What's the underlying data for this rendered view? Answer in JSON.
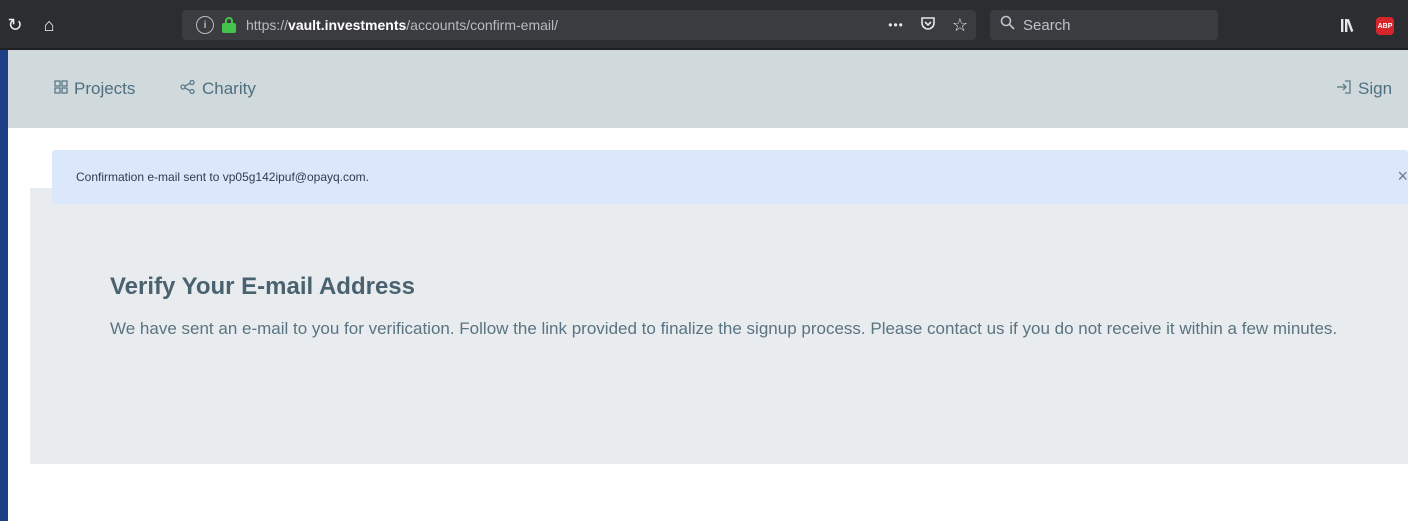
{
  "browser": {
    "url_protocol": "https://",
    "url_host": "vault.investments",
    "url_path": "/accounts/confirm-email/",
    "search_placeholder": "Search",
    "more_dots": "•••",
    "abp_label": "ABP",
    "icons": [
      "reload-icon",
      "home-icon",
      "info-icon",
      "lock-icon",
      "pocket-icon",
      "bookmark-star-icon",
      "search-icon",
      "library-icon",
      "adblock-icon"
    ]
  },
  "nav": {
    "projects_label": "Projects",
    "charity_label": "Charity",
    "signin_label": "Sign"
  },
  "alert": {
    "message": "Confirmation e-mail sent to vp05g142ipuf@opayq.com.",
    "close": "×"
  },
  "content": {
    "title": "Verify Your E-mail Address",
    "body": "We have sent an e-mail to you for verification. Follow the link provided to finalize the signup process. Please contact us if you do not receive it within a few minutes."
  },
  "colors": {
    "navbar_bg": "#d0d9dc",
    "alert_bg": "#dbe7fa",
    "card_bg": "#e9ecef",
    "lock_green": "#43c34c"
  }
}
